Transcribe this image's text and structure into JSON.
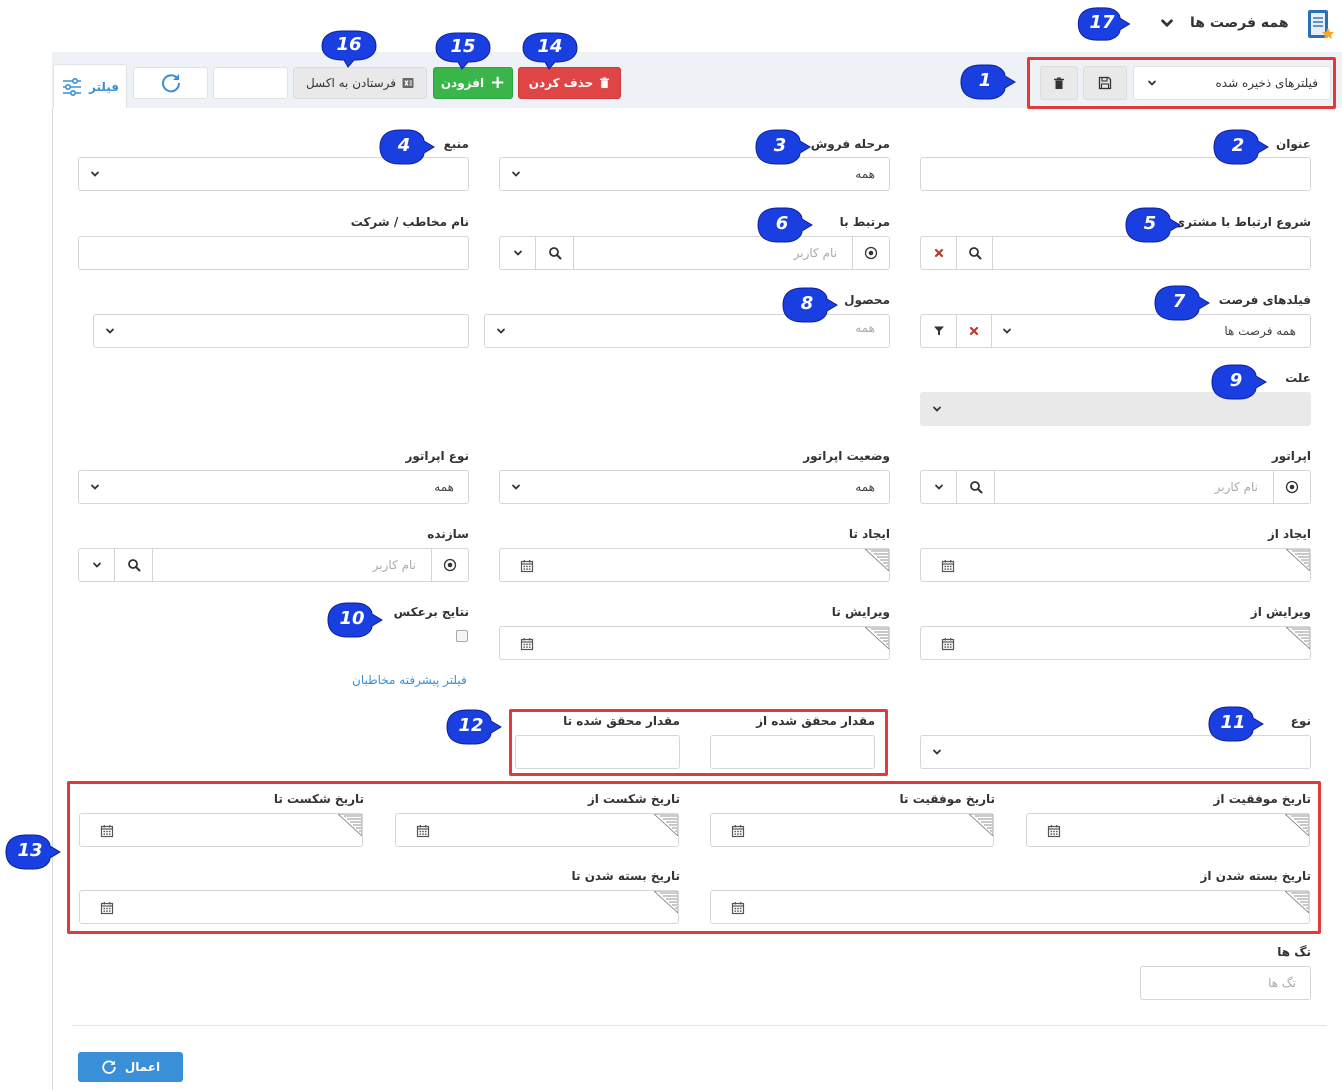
{
  "header": {
    "title": "همه فرصت ها",
    "app_icon": "notebook-icon",
    "callout": "17"
  },
  "toolbar": {
    "saved_filters_label": "فیلترهای ذخیره شده",
    "save_icon": "floppy-disk-icon",
    "delete_icon": "trash-icon",
    "delete_label": "حذف کردن",
    "add_label": "افزودن",
    "excel_label": "فرستادن به اکسل",
    "refresh_icon": "refresh-icon",
    "filter_tab_label": "فیلتر",
    "callouts": {
      "saved": "1",
      "delete": "14",
      "add": "15",
      "excel": "16"
    },
    "colors": {
      "delete": "#e04545",
      "add": "#39b54a",
      "accent": "#3a8fd9"
    }
  },
  "form": {
    "title_label": "عنوان",
    "stage_label": "مرحله فروش",
    "stage_value": "همه",
    "source_label": "منبع",
    "contact_start_label": "شروع ارتباط با مشتری",
    "related_label": "مرتبط با",
    "related_placeholder": "نام کاربر",
    "contact_name_label": "نام مخاطب / شرکت",
    "opp_fields_label": "فیلدهای فرصت",
    "opp_fields_value": "همه فرصت ها",
    "product_label": "محصول",
    "product_value": "همه",
    "reason_label": "علت",
    "operator_label": "اپراتور",
    "operator_placeholder": "نام کاربر",
    "operator_status_label": "وضعیت اپراتور",
    "operator_status_value": "همه",
    "operator_type_label": "نوع اپراتور",
    "operator_type_value": "همه",
    "created_from_label": "ایجاد از",
    "created_to_label": "ایجاد تا",
    "creator_label": "سازنده",
    "creator_placeholder": "نام کاربر",
    "edited_from_label": "ویرایش از",
    "edited_to_label": "ویرایش تا",
    "reverse_label": "نتایج برعکس",
    "advanced_link": "فیلتر پیشرفته مخاطبان",
    "type_label": "نوع",
    "achieved_from_label": "مقدار محقق شده از",
    "achieved_to_label": "مقدار محقق شده تا",
    "success_from_label": "تاریخ موفقیت از",
    "success_to_label": "تاریخ موفقیت تا",
    "fail_from_label": "تاریخ شکست از",
    "fail_to_label": "تاریخ شکست تا",
    "closed_from_label": "تاریخ بسته شدن از",
    "closed_to_label": "تاریخ بسته شدن تا",
    "tags_label": "تگ ها",
    "tags_placeholder": "تگ ها",
    "apply_label": "اعمال",
    "callouts": {
      "title": "2",
      "stage": "3",
      "source": "4",
      "contact_start": "5",
      "related": "6",
      "opp_fields": "7",
      "product": "8",
      "reason": "9",
      "reverse": "10",
      "type": "11",
      "achieved": "12",
      "dates": "13"
    }
  }
}
